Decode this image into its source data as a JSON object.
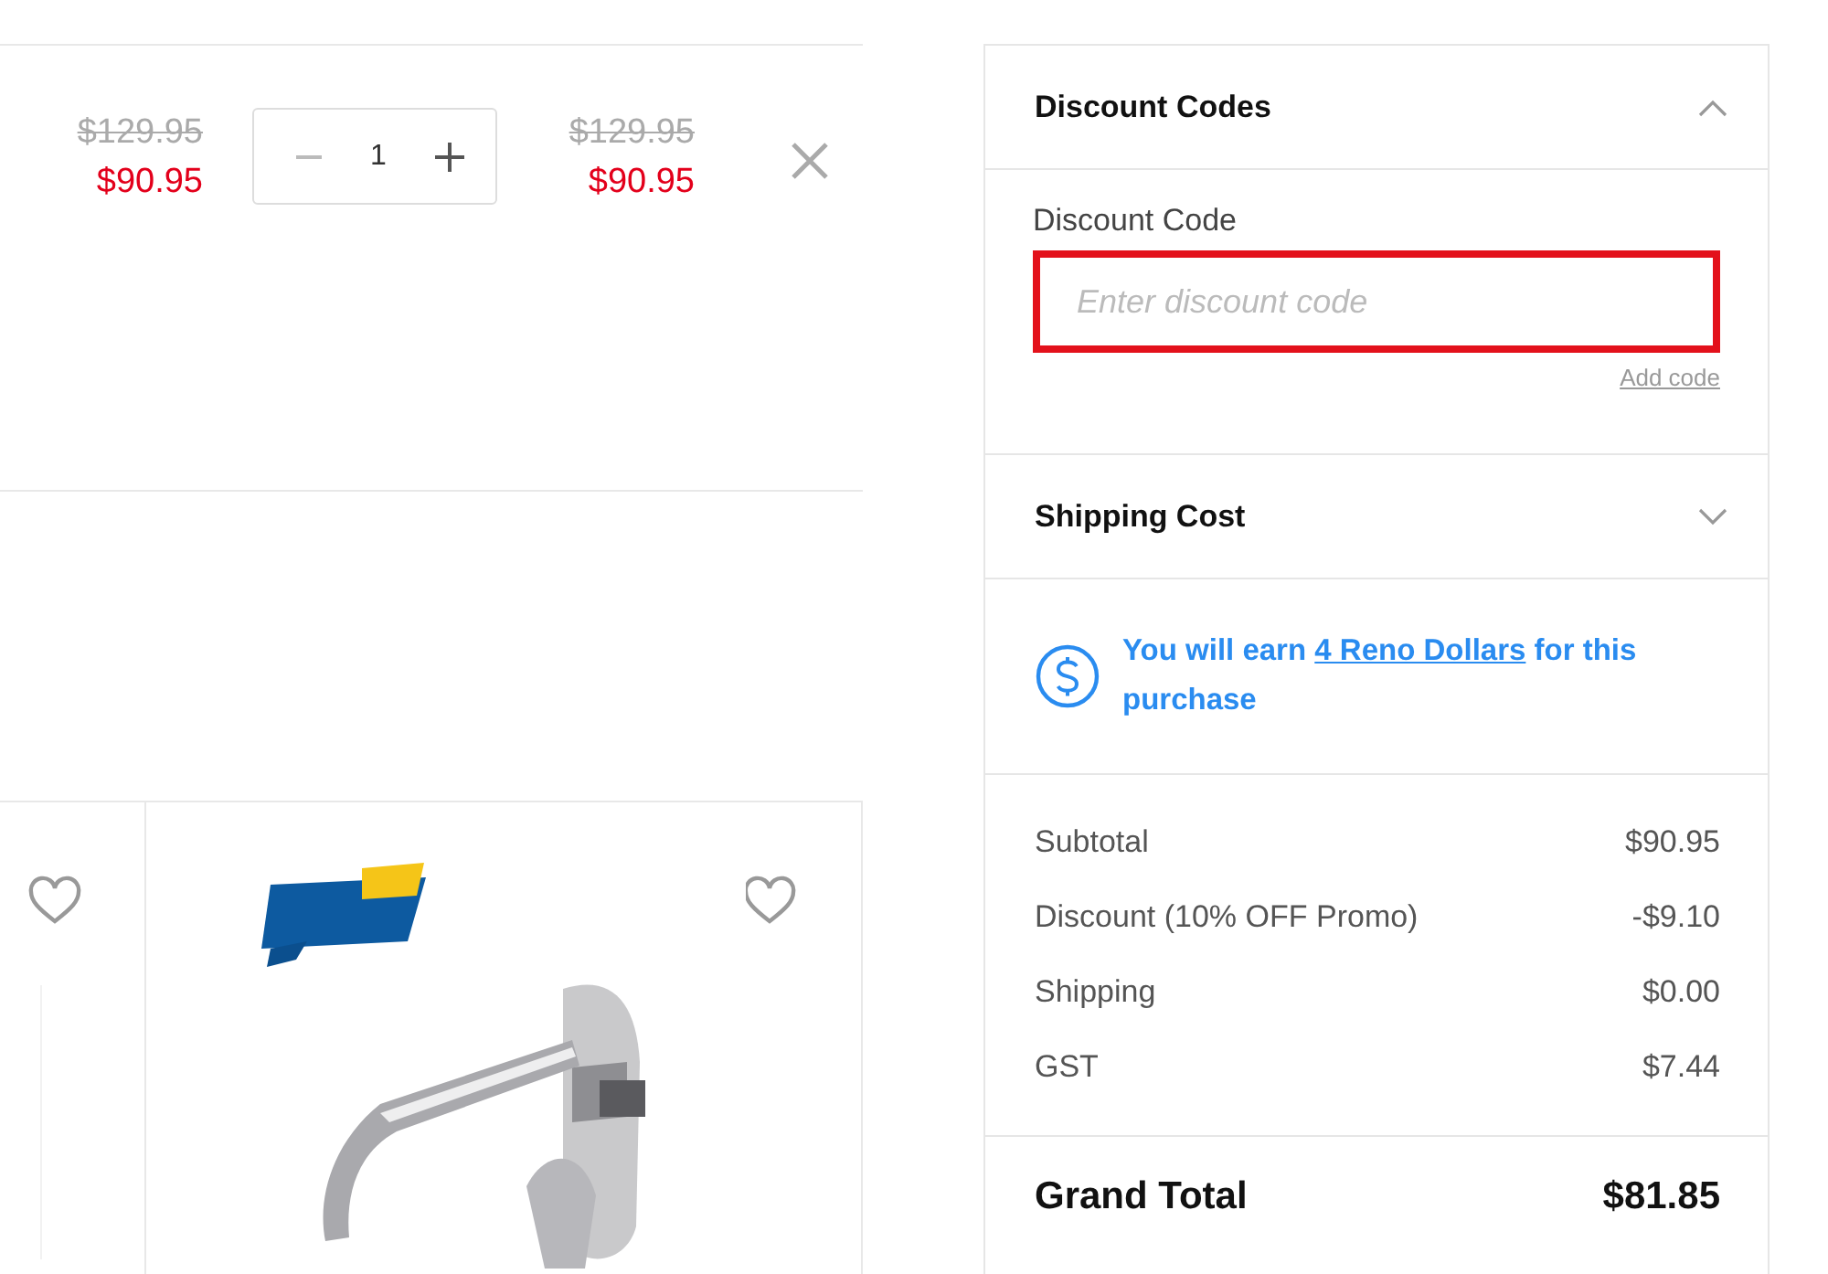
{
  "cart_item": {
    "unit_price_original": "$129.95",
    "unit_price_sale": "$90.95",
    "quantity": "1",
    "total_original": "$129.95",
    "total_sale": "$90.95"
  },
  "products": [
    {
      "favorite": false,
      "kind": "partial"
    },
    {
      "favorite": false,
      "kind": "picture"
    }
  ],
  "sections": [
    {
      "title": "Discount Codes",
      "expanded": true
    },
    {
      "title": "Shipping Cost",
      "expanded": false
    }
  ],
  "discount": {
    "label": "Discount Code",
    "placeholder": "Enter discount code",
    "highlighted": true,
    "action": "Add code"
  },
  "reward": {
    "before": "You will earn",
    "link": "4 Reno Dollars",
    "after": "for this purchase"
  },
  "summary": [
    {
      "label": "Subtotal",
      "value": "$90.95"
    },
    {
      "label": "Discount (10% OFF Promo)",
      "value": "-$9.10"
    },
    {
      "label": "Shipping",
      "value": "$0.00"
    },
    {
      "label": "GST",
      "value": "$7.44"
    }
  ],
  "grand_total": {
    "label": "Grand Total",
    "value": "$81.85"
  }
}
